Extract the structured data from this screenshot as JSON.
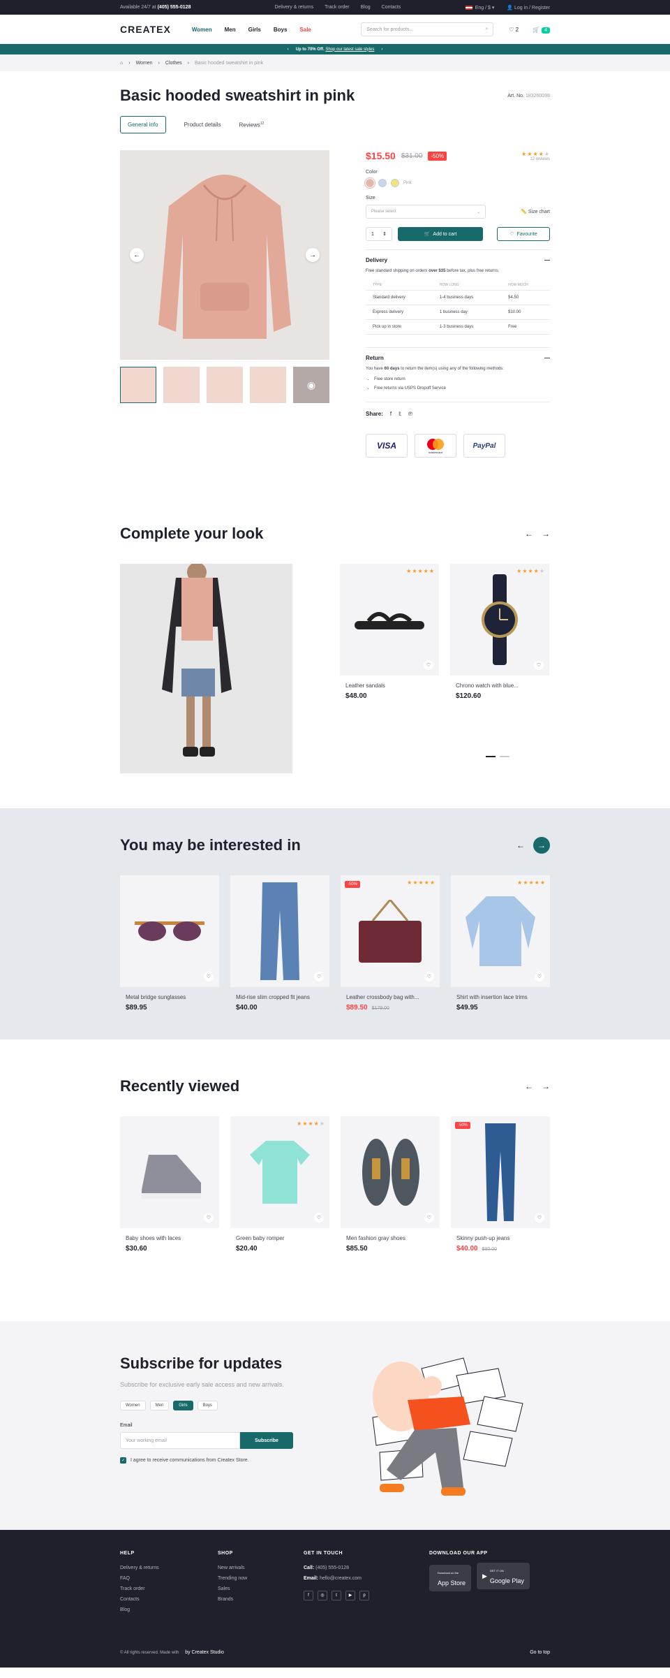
{
  "topbar": {
    "available": "Available 24/7 at",
    "phone": "(405) 555-0128",
    "links": [
      "Delivery & returns",
      "Track order",
      "Blog",
      "Contacts"
    ],
    "lang": "Eng / $",
    "login": "Log in / Register"
  },
  "header": {
    "logo": "CREATEX",
    "nav": [
      "Women",
      "Men",
      "Girls",
      "Boys",
      "Sale"
    ],
    "search_placeholder": "Search for products...",
    "wish_count": "2",
    "cart_count": "4"
  },
  "promo": {
    "bold": "Up to 70% Off.",
    "link": "Shop our latest sale styles"
  },
  "breadcrumbs": [
    "Women",
    "Clothes",
    "Basic hooded sweatshirt in pink"
  ],
  "product": {
    "title": "Basic hooded sweatshirt in pink",
    "art_label": "Art. No.",
    "art_no": "183260098",
    "tabs": [
      "General info",
      "Product details",
      "Reviews"
    ],
    "reviews_sup": "12",
    "price": "$15.50",
    "old_price": "$31.00",
    "discount": "-50%",
    "rating": 4,
    "reviews": "12 reviews",
    "color_label": "Color",
    "color_name": "Pink",
    "swatches": [
      "#e9b4a7",
      "#c6d6ee",
      "#f3e37c"
    ],
    "size_label": "Size",
    "size_placeholder": "Please select",
    "size_chart": "Size chart",
    "qty": "1",
    "add_to_cart": "Add to cart",
    "favourite": "Favourite",
    "delivery": {
      "title": "Delivery",
      "pre": "Free standard shipping on orders ",
      "bold": "over $35",
      "post": " before tax, plus free returns.",
      "headers": [
        "TYPE",
        "HOW LONG",
        "HOW MUCH"
      ],
      "rows": [
        [
          "Standard delivery",
          "1-4 business days",
          "$4.50"
        ],
        [
          "Express delivery",
          "1 business day",
          "$10.00"
        ],
        [
          "Pick up in store",
          "1-3 business days",
          "Free"
        ]
      ]
    },
    "return": {
      "title": "Return",
      "pre": "You have ",
      "bold": "60 days",
      "post": " to return the item(s) using any of the following methods:",
      "methods": [
        "Free store return",
        "Free returns via USPS Dropoff Service"
      ]
    },
    "share_label": "Share:",
    "payments": [
      "VISA",
      "mastercard",
      "PayPal"
    ]
  },
  "look": {
    "title": "Complete your look",
    "items": [
      {
        "name": "Leather sandals",
        "price": "$48.00",
        "rating": 5
      },
      {
        "name": "Chrono watch with blue...",
        "price": "$120.60",
        "rating": 4
      }
    ]
  },
  "interest": {
    "title": "You may be interested in",
    "items": [
      {
        "name": "Metal bridge sunglasses",
        "price": "$89.95"
      },
      {
        "name": "Mid-rise slim cropped fit jeans",
        "price": "$40.00"
      },
      {
        "name": "Leather crossbody bag with...",
        "price": "$89.50",
        "old": "$179.00",
        "badge": "-50%",
        "rating": 5
      },
      {
        "name": "Shirt with insertion lace trims",
        "price": "$49.95",
        "rating": 5
      }
    ]
  },
  "recent": {
    "title": "Recently viewed",
    "items": [
      {
        "name": "Baby shoes with laces",
        "price": "$30.60"
      },
      {
        "name": "Green baby romper",
        "price": "$20.40",
        "rating": 4
      },
      {
        "name": "Men fashion gray shoes",
        "price": "$85.50"
      },
      {
        "name": "Skinny push-up jeans",
        "price": "$40.00",
        "old": "$80.00",
        "badge": "-50%"
      }
    ]
  },
  "subscribe": {
    "title": "Subscribe for updates",
    "desc": "Subscribe for exclusive early sale access and new arrivals.",
    "chips": [
      "Women",
      "Men",
      "Girls",
      "Boys"
    ],
    "email_label": "Email",
    "email_placeholder": "Your working email",
    "button": "Subscribe",
    "agree": "I agree to receive communications from Createx Store."
  },
  "footer": {
    "help_title": "HELP",
    "help": [
      "Delivery & returns",
      "FAQ",
      "Track order",
      "Contacts",
      "Blog"
    ],
    "shop_title": "SHOP",
    "shop": [
      "New arrivals",
      "Trending now",
      "Sales",
      "Brands"
    ],
    "touch_title": "GET IN TOUCH",
    "call_label": "Call:",
    "call": "(405) 555-0128",
    "email_label": "Email:",
    "email": "hello@createx.com",
    "app_title": "DOWNLOAD OUR APP",
    "appstore_small": "Download on the",
    "appstore": "App Store",
    "gplay_small": "GET IT ON",
    "gplay": "Google Play",
    "copyright": "© All rights reserved. Made with",
    "by": "by Createx Studio",
    "gotop": "Go to top"
  }
}
